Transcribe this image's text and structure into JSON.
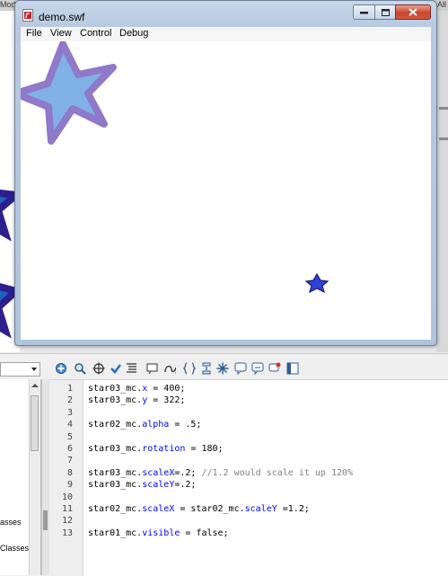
{
  "ide": {
    "top_fragments": [
      "Mod",
      "All"
    ]
  },
  "player": {
    "title": "demo.swf",
    "menu": [
      "File",
      "View",
      "Control",
      "Debug"
    ],
    "colors": {
      "big_star_fill": "#7fb0e6",
      "big_star_stroke": "#8f79c8",
      "small_star_fill": "#2d43d8",
      "small_star_stroke": "#1a1a7a",
      "left_star_fill": "#1f62c0",
      "left_star_stroke": "#2e1f8f"
    }
  },
  "library": {
    "items": [
      "asses",
      "Classes"
    ]
  },
  "toolbar": {
    "icons": [
      "add-statement-icon",
      "find-icon",
      "target-path-icon",
      "check-syntax-icon",
      "auto-format-icon",
      "code-hint-icon",
      "debug-options-icon",
      "collapse-between-braces-icon",
      "collapse-selection-icon",
      "expand-all-icon",
      "apply-block-comment-icon",
      "apply-line-comment-icon",
      "remove-comment-icon",
      "show-hide-toolbox-icon"
    ]
  },
  "editor": {
    "lines": [
      {
        "num": "1",
        "segments": [
          {
            "t": "star03_mc.",
            "k": "n"
          },
          {
            "t": "x",
            "k": "p"
          },
          {
            "t": " = 400;",
            "k": "n"
          }
        ]
      },
      {
        "num": "2",
        "segments": [
          {
            "t": "star03_mc.",
            "k": "n"
          },
          {
            "t": "y",
            "k": "p"
          },
          {
            "t": " = 322;",
            "k": "n"
          }
        ]
      },
      {
        "num": "3",
        "segments": []
      },
      {
        "num": "4",
        "segments": [
          {
            "t": "star02_mc.",
            "k": "n"
          },
          {
            "t": "alpha",
            "k": "p"
          },
          {
            "t": " = .5;",
            "k": "n"
          }
        ]
      },
      {
        "num": "5",
        "segments": []
      },
      {
        "num": "6",
        "segments": [
          {
            "t": "star03_mc.",
            "k": "n"
          },
          {
            "t": "rotation",
            "k": "p"
          },
          {
            "t": " = 180;",
            "k": "n"
          }
        ]
      },
      {
        "num": "7",
        "segments": []
      },
      {
        "num": "8",
        "segments": [
          {
            "t": "star03_mc.",
            "k": "n"
          },
          {
            "t": "scaleX",
            "k": "p"
          },
          {
            "t": "=.2; ",
            "k": "n"
          },
          {
            "t": "//1.2 would scale it up 120%",
            "k": "c"
          }
        ]
      },
      {
        "num": "9",
        "segments": [
          {
            "t": "star03_mc.",
            "k": "n"
          },
          {
            "t": "scaleY",
            "k": "p"
          },
          {
            "t": "=.2;",
            "k": "n"
          }
        ]
      },
      {
        "num": "10",
        "segments": []
      },
      {
        "num": "11",
        "segments": [
          {
            "t": "star02_mc.",
            "k": "n"
          },
          {
            "t": "scaleX",
            "k": "p"
          },
          {
            "t": " = star02_mc.",
            "k": "n"
          },
          {
            "t": "scaleY",
            "k": "p"
          },
          {
            "t": " =1.2;",
            "k": "n"
          }
        ]
      },
      {
        "num": "12",
        "segments": []
      },
      {
        "num": "13",
        "segments": [
          {
            "t": "star01_mc.",
            "k": "n"
          },
          {
            "t": "visible",
            "k": "p"
          },
          {
            "t": " = false;",
            "k": "n"
          }
        ]
      }
    ]
  }
}
